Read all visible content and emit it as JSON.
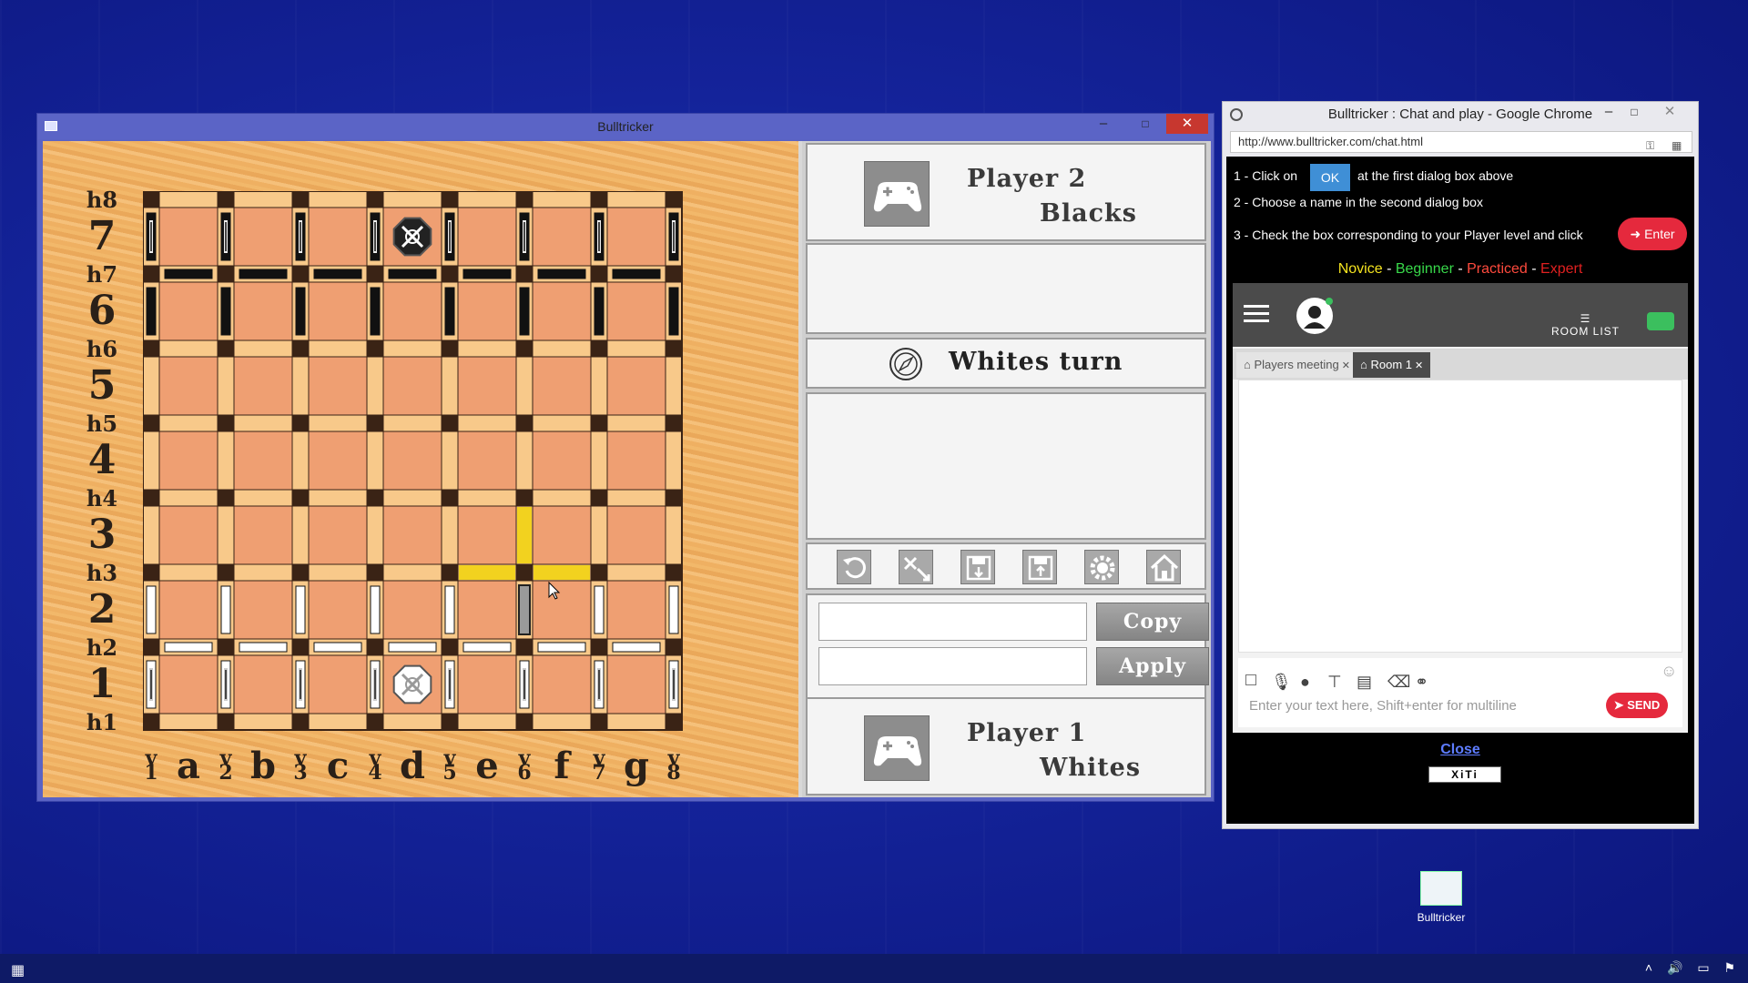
{
  "game_window": {
    "title": "Bulltricker",
    "controls": {
      "minimize": "–",
      "maximize": "□",
      "close": "✕"
    },
    "board": {
      "row_labels": [
        "h8",
        "7",
        "h7",
        "6",
        "h6",
        "5",
        "h5",
        "4",
        "h4",
        "3",
        "h3",
        "2",
        "h2",
        "1",
        "h1"
      ],
      "col_labels": [
        "v1",
        "a",
        "v2",
        "b",
        "v3",
        "c",
        "v4",
        "d",
        "v5",
        "e",
        "v6",
        "f",
        "v7",
        "g",
        "v8"
      ],
      "pieces": {
        "black_king": "d7",
        "white_king": "d1",
        "black_pawns_row7": [
          "v1",
          "v2",
          "v3",
          "v4",
          "v5",
          "v6",
          "v7",
          "v8"
        ],
        "black_queens_h7": [
          "a",
          "b",
          "c",
          "d",
          "e",
          "f",
          "g"
        ],
        "black_pawns_row6": [
          "v1",
          "v2",
          "v3",
          "v4",
          "v5",
          "v6",
          "v7",
          "v8"
        ],
        "white_pawns_row2": [
          "v1",
          "v2",
          "v3",
          "v4",
          "v5",
          "v7",
          "v8"
        ],
        "white_pawn_selected": "v6-2",
        "white_queens_h2": [
          "a",
          "b",
          "c",
          "d",
          "e",
          "f",
          "g"
        ],
        "white_pawns_row1": [
          "v1",
          "v2",
          "v3",
          "v4",
          "v5",
          "v6",
          "v7",
          "v8"
        ]
      },
      "highlighted_moves": [
        "v6-3",
        "e-h3",
        "f-h3"
      ],
      "colors": {
        "light_square": "#f8c98a",
        "dark_square": "#ef9f72",
        "highlight": "#f2d21f",
        "grid": "#3a2315"
      }
    },
    "panel": {
      "player2": {
        "name": "Player 2",
        "color": "Blacks",
        "icon": "gamepad-icon"
      },
      "turn": {
        "text": "Whites turn",
        "icon": "compass-icon"
      },
      "tools": [
        "undo-icon",
        "rotate-board-icon",
        "save-icon",
        "load-icon",
        "settings-icon",
        "home-icon"
      ],
      "copy_label": "Copy",
      "apply_label": "Apply",
      "player1": {
        "name": "Player 1",
        "color": "Whites",
        "icon": "gamepad-icon"
      }
    }
  },
  "chrome_window": {
    "title": "Bulltricker : Chat and play - Google Chrome",
    "url": "http://www.bulltricker.com/chat.html",
    "instructions": {
      "step1_prefix": "1 - Click on",
      "ok_label": "OK",
      "step1_suffix": "at the first dialog box above",
      "step2": "2 - Choose a name in the second dialog box",
      "step3": "3 - Check the box corresponding to your Player level and click",
      "enter_label": "Enter"
    },
    "levels": [
      {
        "label": "Novice",
        "color": "#f5e41f"
      },
      {
        "label": "Beginner",
        "color": "#38d94a"
      },
      {
        "label": "Practiced",
        "color": "#ff4a3d"
      },
      {
        "label": "Expert",
        "color": "#e02020"
      }
    ],
    "level_separator": " - ",
    "chat": {
      "room_list_label": "ROOM LIST",
      "tabs": [
        {
          "label": "Players meeting",
          "active": false
        },
        {
          "label": "Room 1",
          "active": true
        }
      ],
      "input_placeholder": "Enter your text here, Shift+enter for multiline",
      "send_label": "SEND"
    },
    "close_label": "Close",
    "xiti_label": "XiTi"
  },
  "desktop": {
    "shortcut_label": "Bulltricker"
  },
  "accent_colors": {
    "desktop_blue": "#14239a",
    "window_frame": "#5a63c4",
    "close_red": "#c7372f",
    "chat_red": "#e5293d",
    "ok_blue": "#3f8fd6"
  }
}
